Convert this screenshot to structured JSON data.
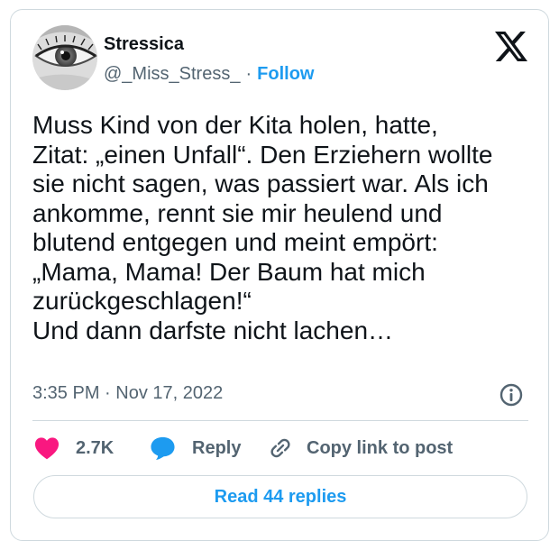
{
  "user": {
    "display_name": "Stressica",
    "handle": "@_Miss_Stress_",
    "separator": "·",
    "follow_label": "Follow",
    "avatar_icon": "eye-avatar"
  },
  "tweet": {
    "text": "Muss Kind von der Kita holen, hatte,\nZitat: „einen Unfall“. Den Erziehern wollte\nsie nicht sagen, was passiert war. Als ich\nankomme, rennt sie mir heulend und\nblutend entgegen und meint empört:\n„Mama, Mama! Der Baum hat mich\nzurückgeschlagen!“\nUnd dann darfste nicht lachen…",
    "timestamp": "3:35 PM · Nov 17, 2022"
  },
  "actions": {
    "like_count": "2.7K",
    "reply_label": "Reply",
    "copy_label": "Copy link to post",
    "read_replies_label": "Read 44 replies"
  },
  "colors": {
    "accent": "#1d9bf0",
    "like": "#f91880",
    "text": "#0f1419",
    "muted": "#536471",
    "border": "#cfd9de"
  }
}
